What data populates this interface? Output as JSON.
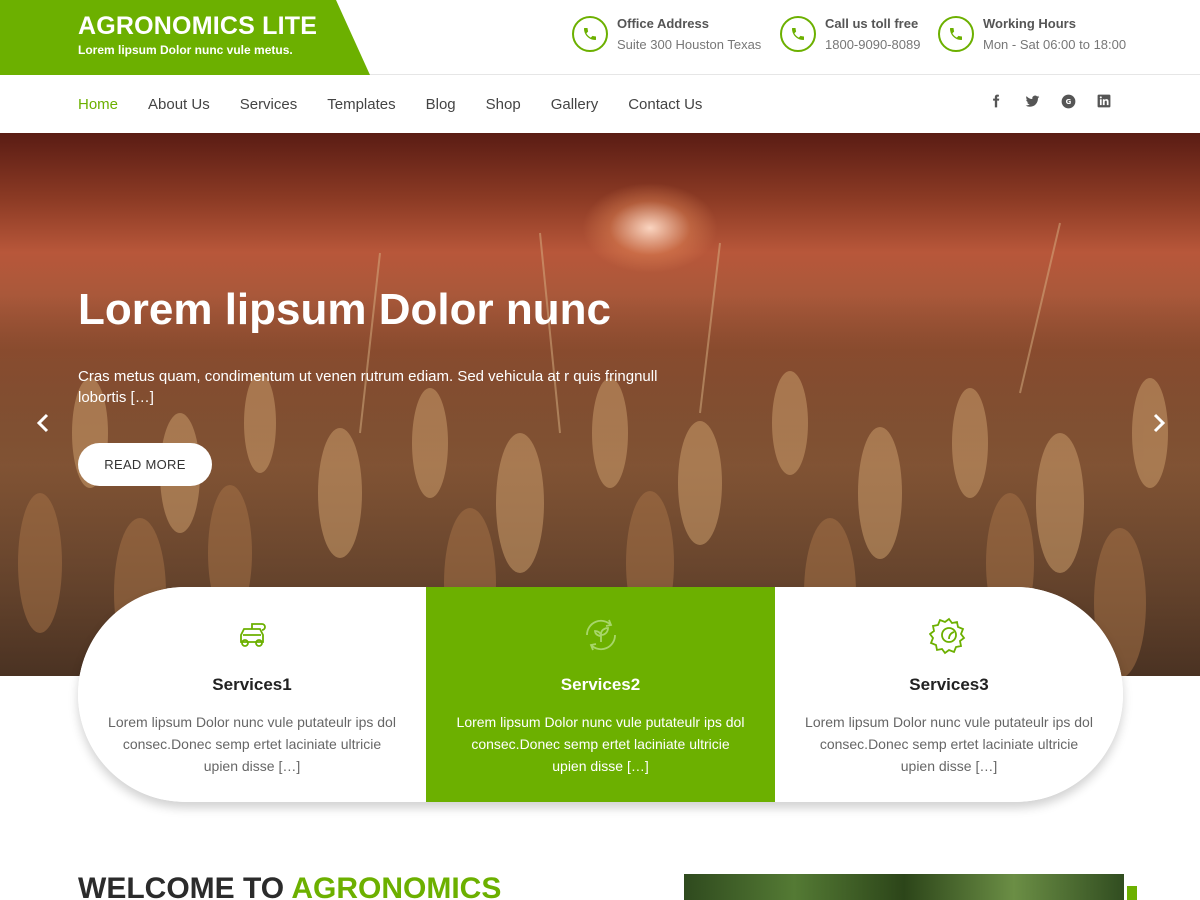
{
  "brand": {
    "title": "AGRONOMICS LITE",
    "tagline": "Lorem lipsum Dolor nunc vule metus.",
    "color": "#6cb000"
  },
  "contact_info": [
    {
      "heading": "Office Address",
      "value": "Suite 300 Houston Texas",
      "icon": "phone-icon"
    },
    {
      "heading": "Call us toll free",
      "value": "1800-9090-8089",
      "icon": "phone-icon"
    },
    {
      "heading": "Working Hours",
      "value": "Mon - Sat 06:00 to 18:00",
      "icon": "phone-icon"
    }
  ],
  "nav": {
    "items": [
      {
        "label": "Home",
        "active": true
      },
      {
        "label": "About Us"
      },
      {
        "label": "Services"
      },
      {
        "label": "Templates"
      },
      {
        "label": "Blog"
      },
      {
        "label": "Shop"
      },
      {
        "label": "Gallery"
      },
      {
        "label": "Contact Us"
      }
    ],
    "social": [
      {
        "name": "facebook-icon",
        "glyph": "f"
      },
      {
        "name": "twitter-icon",
        "glyph": ""
      },
      {
        "name": "google-plus-icon",
        "glyph": "G+"
      },
      {
        "name": "linkedin-icon",
        "glyph": "in"
      }
    ]
  },
  "hero": {
    "title": "Lorem lipsum Dolor nunc",
    "text": "Cras metus quam, condimentum ut venen rutrum ediam. Sed vehicula at r quis fringnull lobortis […]",
    "button": "READ MORE"
  },
  "services": [
    {
      "title": "Services1",
      "text": "Lorem lipsum Dolor nunc vule putateulr ips dol consec.Donec semp ertet laciniate ultricie upien disse […]",
      "icon": "tractor-icon"
    },
    {
      "title": "Services2",
      "text": "Lorem lipsum Dolor nunc vule putateulr ips dol consec.Donec semp ertet laciniate ultricie upien disse […]",
      "icon": "recycle-leaf-icon"
    },
    {
      "title": "Services3",
      "text": "Lorem lipsum Dolor nunc vule putateulr ips dol consec.Donec semp ertet laciniate ultricie upien disse […]",
      "icon": "gear-leaf-icon"
    }
  ],
  "welcome": {
    "prefix": "WELCOME TO",
    "highlight": "AGRONOMICS"
  }
}
